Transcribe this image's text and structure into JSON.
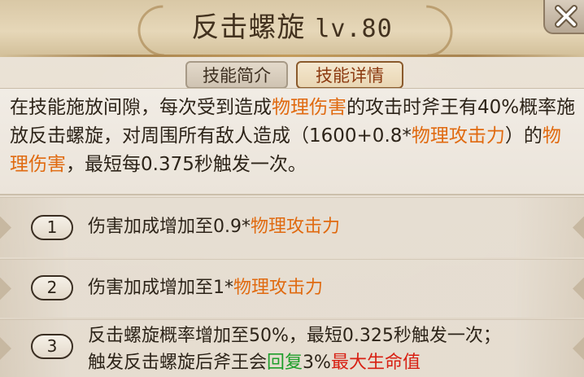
{
  "colors": {
    "highlight_orange": "#e06a10",
    "highlight_green": "#1e9e2a",
    "highlight_red": "#d81f12",
    "active_tab_text": "#8c3a10"
  },
  "header": {
    "title": "反击螺旋",
    "level": "lv.80",
    "close_icon": "close-x-icon"
  },
  "tabs": [
    {
      "label": "技能简介",
      "active": false
    },
    {
      "label": "技能详情",
      "active": true
    }
  ],
  "description": {
    "seg1": "在技能施放间隙，每次受到造成",
    "hl1": "物理伤害",
    "seg2": "的攻击时斧王有40%概率施放反击螺旋，对周围所有敌人造成（1600+0.8*",
    "hl2": "物理攻击力",
    "seg3": "）的",
    "hl3": "物理伤害",
    "seg4": "，最短每0.375秒触发一次。"
  },
  "upgrades": [
    {
      "number": "1",
      "text": "伤害加成增加至0.9*",
      "highlight": "物理攻击力"
    },
    {
      "number": "2",
      "text": "伤害加成增加至1*",
      "highlight": "物理攻击力"
    },
    {
      "number": "3",
      "line1": "反击螺旋概率增加至50%，最短0.325秒触发一次；",
      "line2_text": "触发反击螺旋后斧王会",
      "line2_green": "回复",
      "line2_mid": "3%",
      "line2_red": "最大生命值"
    }
  ]
}
